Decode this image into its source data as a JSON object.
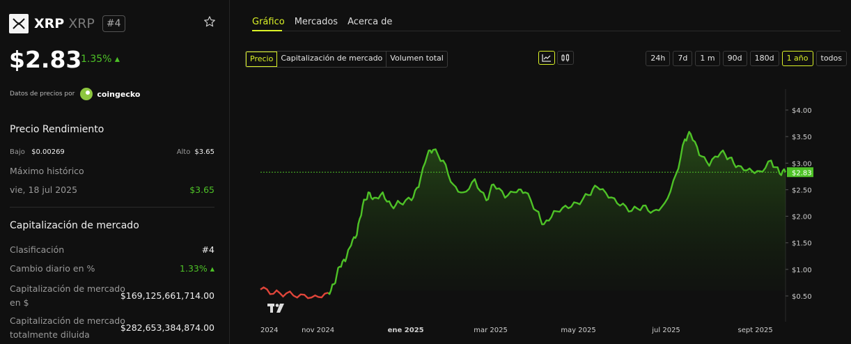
{
  "coin": {
    "symbol": "XRP",
    "name": "XRP",
    "rank": "#4",
    "price": "$2.83",
    "change": "1.35% ▴"
  },
  "attribution": {
    "label": "Datos de precios por",
    "brand": "coingecko"
  },
  "performance": {
    "title": "Precio Rendimiento",
    "low_label": "Bajo",
    "low": "$0.00269",
    "high_label": "Alto",
    "high": "$3.65",
    "ath_label": "Máximo histórico",
    "ath_date": "vie, 18 jul 2025",
    "ath_value": "$3.65"
  },
  "market_cap": {
    "title": "Capitalización de mercado",
    "rank_label": "Clasificación",
    "rank_value": "#4",
    "daily_label": "Cambio diario en %",
    "daily_value": "1.33% ▴",
    "usd_label_1": "Capitalización de mercado",
    "usd_label_2": "en $",
    "usd_value": "$169,125,661,714.00",
    "fdv_label_1": "Capitalización de mercado",
    "fdv_label_2": "totalmente diluida",
    "fdv_value": "$282,653,384,874.00"
  },
  "tabs": [
    "Gráfico",
    "Mercados",
    "Acerca de"
  ],
  "metric_buttons": [
    "Precio",
    "Capitalización de mercado",
    "Volumen total"
  ],
  "range_buttons": [
    "24h",
    "7d",
    "1 m",
    "90d",
    "180d",
    "1 año",
    "todos"
  ],
  "icons": {
    "line": "line-chart-icon",
    "candle": "candlestick-icon",
    "star": "star-icon",
    "logo": "xrp-logo-icon",
    "tv": "tradingview-logo"
  },
  "colors": {
    "accent": "#dbf227",
    "up": "#4ec227",
    "down": "#e0453a",
    "line": "#4ec227"
  },
  "chart_data": {
    "type": "line",
    "ylim": [
      0.3,
      4.4
    ],
    "y_ticks": [
      "$4.00",
      "$3.50",
      "$3.00",
      "$2.50",
      "$2.00",
      "$1.50",
      "$1.00",
      "$0.50"
    ],
    "x_ticks": [
      "2024",
      "nov 2024",
      "ene 2025",
      "mar 2025",
      "may 2025",
      "jul 2025",
      "sept 2025"
    ],
    "current_label": "$2.83",
    "current_value": 2.83,
    "series": [
      {
        "x": [
          "2024-09-22",
          "2024-10-01",
          "2024-10-10",
          "2024-10-20",
          "2024-10-30",
          "2024-11-08",
          "2024-11-12",
          "2024-11-16",
          "2024-11-20",
          "2024-11-24",
          "2024-11-28",
          "2024-12-02",
          "2024-12-06",
          "2024-12-10",
          "2024-12-16",
          "2024-12-22",
          "2024-12-28",
          "2025-01-05",
          "2025-01-10",
          "2025-01-16",
          "2025-01-20",
          "2025-01-27",
          "2025-02-03",
          "2025-02-10",
          "2025-02-18",
          "2025-02-26",
          "2025-03-03",
          "2025-03-11",
          "2025-03-19",
          "2025-03-25",
          "2025-04-02",
          "2025-04-07",
          "2025-04-14",
          "2025-04-22",
          "2025-04-30",
          "2025-05-08",
          "2025-05-14",
          "2025-05-22",
          "2025-05-30",
          "2025-06-07",
          "2025-06-15",
          "2025-06-22",
          "2025-06-30",
          "2025-07-08",
          "2025-07-14",
          "2025-07-18",
          "2025-07-24",
          "2025-07-31",
          "2025-08-08",
          "2025-08-14",
          "2025-08-20",
          "2025-08-28",
          "2025-09-04",
          "2025-09-12",
          "2025-09-18",
          "2025-09-22"
        ],
        "y": [
          0.62,
          0.54,
          0.55,
          0.53,
          0.51,
          0.56,
          0.72,
          1.05,
          1.15,
          1.45,
          1.65,
          2.2,
          2.45,
          2.35,
          2.45,
          2.2,
          2.25,
          2.3,
          2.55,
          3.15,
          3.25,
          3.05,
          2.6,
          2.45,
          2.7,
          2.3,
          2.6,
          2.35,
          2.45,
          2.45,
          2.1,
          1.85,
          2.1,
          2.2,
          2.25,
          2.4,
          2.55,
          2.35,
          2.2,
          2.1,
          2.2,
          2.1,
          2.25,
          2.8,
          3.45,
          3.55,
          3.15,
          2.95,
          3.2,
          3.1,
          2.95,
          2.9,
          2.85,
          3.05,
          2.8,
          2.83
        ]
      }
    ]
  }
}
